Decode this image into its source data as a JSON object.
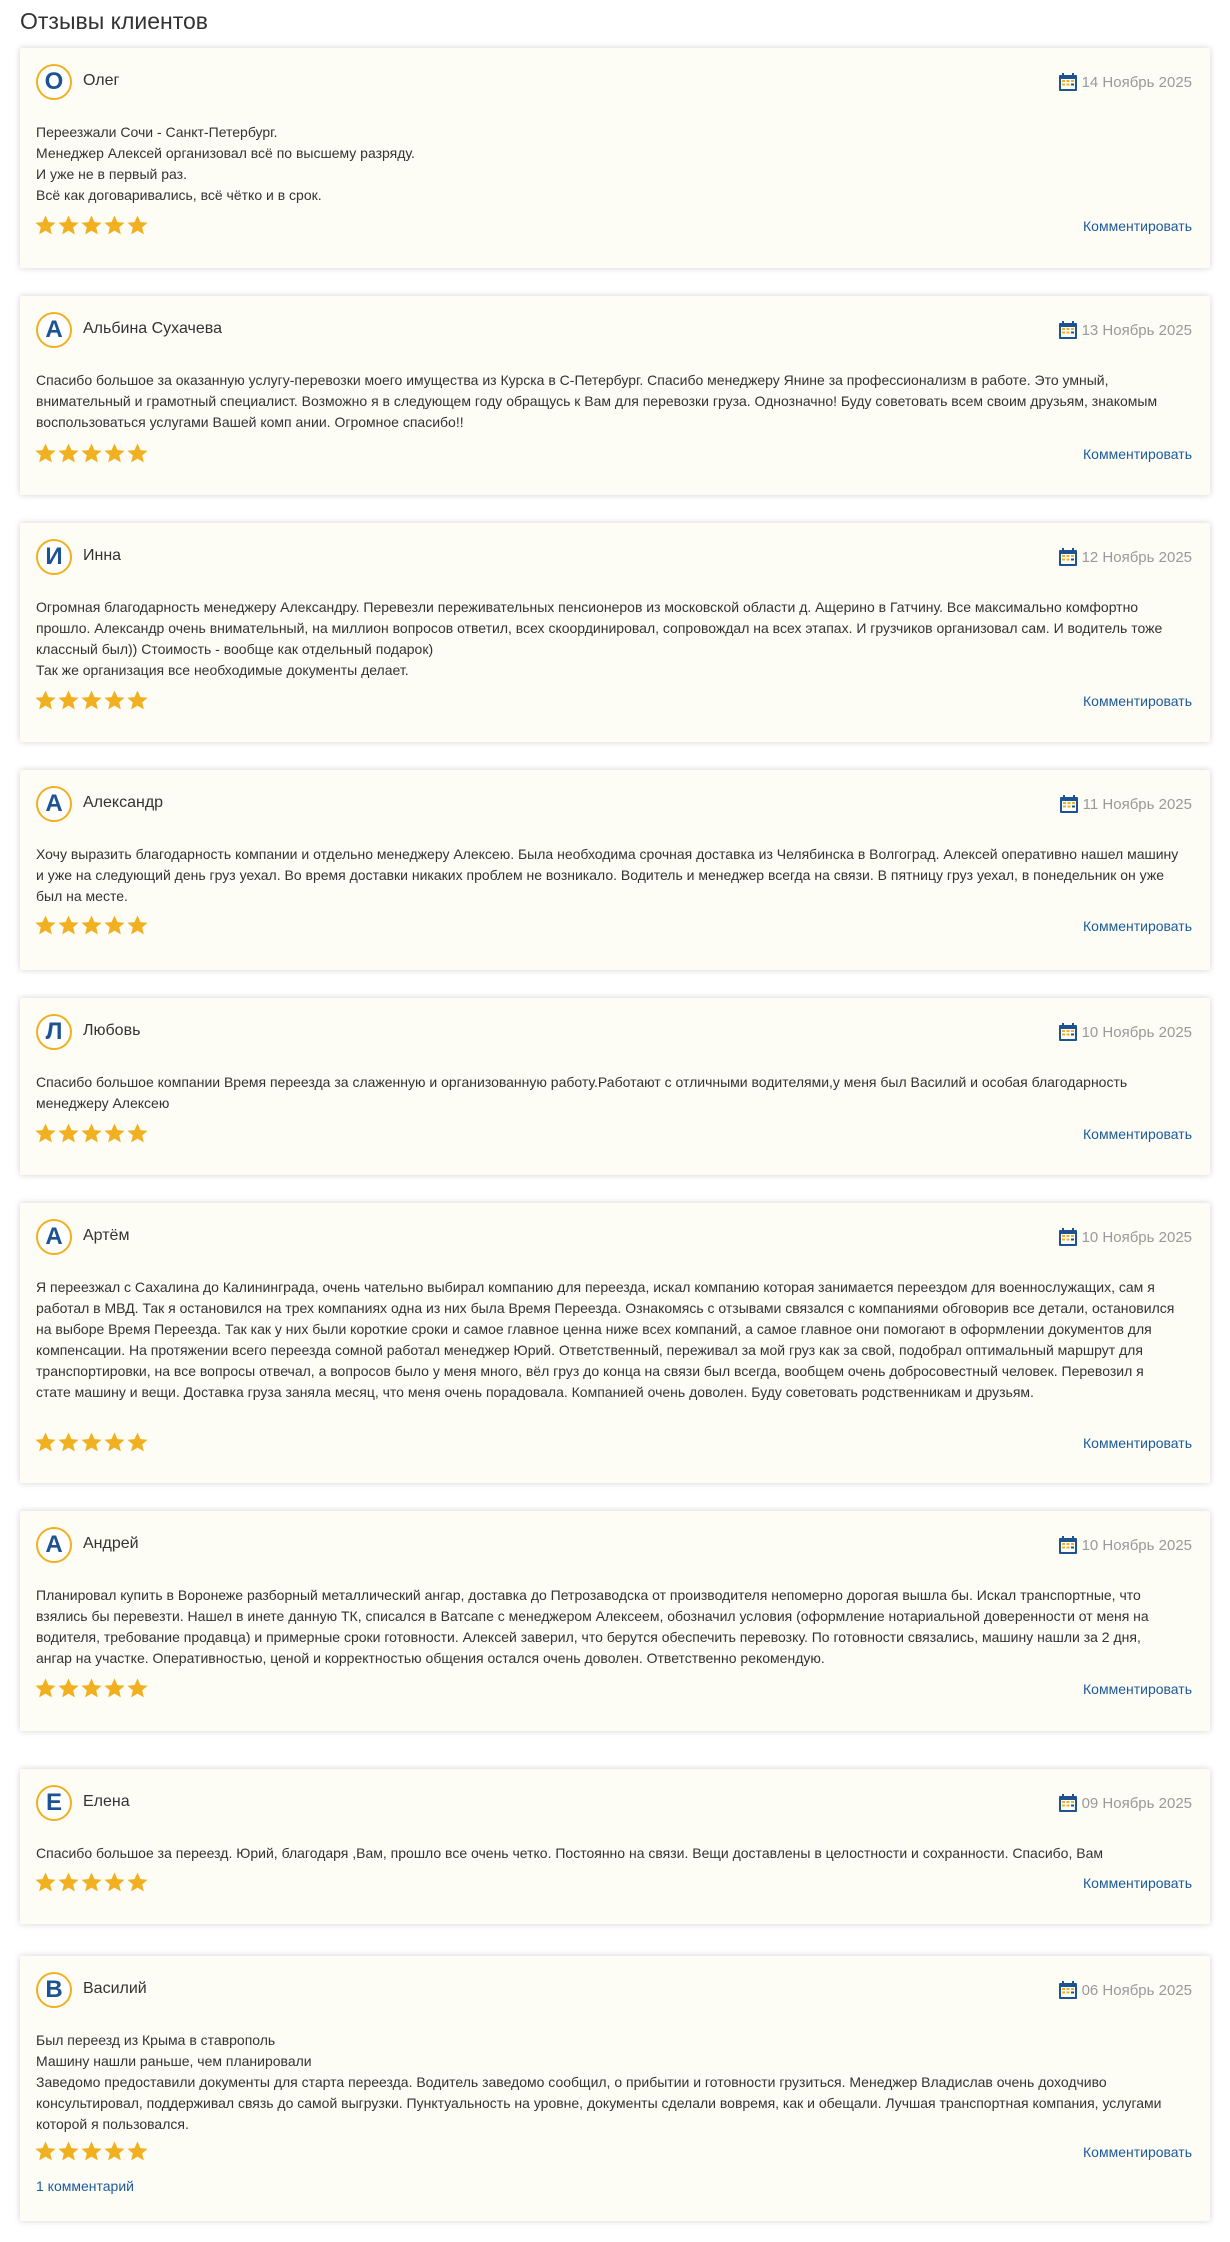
{
  "page": {
    "title": "Отзывы клиентов"
  },
  "colors": {
    "accent_gold": "#f0b020",
    "avatar_letter": "#1d5393",
    "link": "#1d5a9b",
    "card_bg": "#fdfcf5",
    "date": "#9a9a9a"
  },
  "icons": {
    "calendar": "calendar-icon",
    "star": "star-icon"
  },
  "reviews": [
    {
      "initial": "О",
      "author": "Олег",
      "date": "14 Ноябрь 2025",
      "text": "Переезжали Сочи - Санкт-Петербург.\nМенеджер Алексей организовал всё по высшему разряду.\nИ уже не в первый раз.\nВсё как договаривались, всё чётко и в срок.",
      "rating": 5,
      "comment_label": "Комментировать"
    },
    {
      "initial": "А",
      "author": "Альбина Сухачева",
      "date": "13 Ноябрь 2025",
      "text": "Спасибо большое за оказанную услугу-перевозки моего имущества из Курска в С-Петербург. Спасибо менеджеру Янине за профессионализм в работе. Это умный, внимательный и грамотный специалист. Возможно я в следующем году обращусь к Вам для перевозки груза. Однозначно! Буду советовать всем своим друзьям, знакомым воспользоваться услугами Вашей комп ании. Огромное спасибо!!",
      "rating": 5,
      "comment_label": "Комментировать"
    },
    {
      "initial": "И",
      "author": "Инна",
      "date": "12 Ноябрь 2025",
      "text": "Огромная благодарность менеджеру Александру. Перевезли переживательных пенсионеров из московской области д. Ащерино в Гатчину. Все максимально комфортно прошло. Александр очень внимательный, на миллион вопросов ответил, всех скоординировал, сопровождал на всех этапах. И грузчиков организовал сам. И водитель тоже классный был)) Стоимость - вообще как отдельный подарок)\nТак же организация все необходимые документы делает.",
      "rating": 5,
      "comment_label": "Комментировать"
    },
    {
      "initial": "А",
      "author": "Александр",
      "date": "11 Ноябрь 2025",
      "text": "Хочу выразить благодарность компании и отдельно менеджеру Алексею. Была необходима срочная доставка из Челябинска в Волгоград. Алексей оперативно нашел машину и уже на следующий день груз уехал. Во время доставки никаких проблем не возникало. Водитель и менеджер всегда на связи. В пятницу груз уехал, в понедельник он уже был на месте.",
      "rating": 5,
      "comment_label": "Комментировать"
    },
    {
      "initial": "Л",
      "author": "Любовь",
      "date": "10 Ноябрь 2025",
      "text": "Спасибо большое компании Время переезда за слаженную и организованную работу.Работают с отличными водителями,у меня был Василий и особая благодарность менеджеру Алексею",
      "rating": 5,
      "comment_label": "Комментировать"
    },
    {
      "initial": "А",
      "author": "Артём",
      "date": "10 Ноябрь 2025",
      "text": "Я переезжал с Сахалина до Калининграда, очень чательно выбирал компанию для переезда, искал компанию которая занимается переездом для военнослужащих, сам я работал в МВД. Так я остановился на трех компаниях одна из них была Время Переезда. Ознакомясь с отзывами связался с компаниями обговорив все детали, остановился на выборе Время Переезда. Так как у них были короткие сроки и самое главное ценна ниже всех компаний, а самое главное они помогают в оформлении документов для компенсации. На протяжении всего переезда сомной работал менеджер Юрий. Ответственный, переживал за мой груз как за свой, подобрал оптимальный маршрут для транспортировки, на все вопросы отвечал, а вопросов было у меня много, вёл груз до конца на связи был всегда, вообщем очень добросовестный человек. Перевозил я стате машину и вещи. Доставка груза заняла месяц, что меня очень порадовала. Компанией очень доволен. Буду советовать родственникам и друзьям.",
      "rating": 5,
      "comment_label": "Комментировать"
    },
    {
      "initial": "А",
      "author": "Андрей",
      "date": "10 Ноябрь 2025",
      "text": "Планировал купить в Воронеже разборный металлический ангар, доставка до Петрозаводска от производителя непомерно дорогая вышла бы. Искал транспортные, что взялись бы перевезти. Нашел в инете данную ТК, списался в Ватсапе с менеджером Алексеем, обозначил условия (оформление нотариальной доверенности от меня на водителя, требование продавца) и примерные сроки готовности. Алексей заверил, что берутся обеспечить перевозку. По готовности связались, машину нашли за 2 дня, ангар на участке. Оперативностью, ценой и корректностью общения остался очень доволен. Ответственно рекомендую.",
      "rating": 5,
      "comment_label": "Комментировать"
    },
    {
      "initial": "Е",
      "author": "Елена",
      "date": "09 Ноябрь 2025",
      "text": "Спасибо большое за переезд. Юрий, благодаря ,Вам, прошло все очень четко. Постоянно на связи. Вещи доставлены в целостности и сохранности. Спасибо, Вам",
      "rating": 5,
      "comment_label": "Комментировать"
    },
    {
      "initial": "В",
      "author": "Василий",
      "date": "06 Ноябрь 2025",
      "text": "Был переезд из Крыма в ставрополь\nМашину нашли раньше, чем планировали\nЗаведомо предоставили документы для старта переезда. Водитель заведомо сообщил, о прибытии и готовности грузиться. Менеджер Владислав очень доходчиво консультировал, поддерживал связь до самой выгрузки. Пунктуальность на уровне, документы сделали вовремя, как и обещали. Лучшая транспортная компания, услугами которой я пользовался.",
      "rating": 5,
      "comment_label": "Комментировать",
      "comments_count_label": "1 комментарий"
    }
  ]
}
